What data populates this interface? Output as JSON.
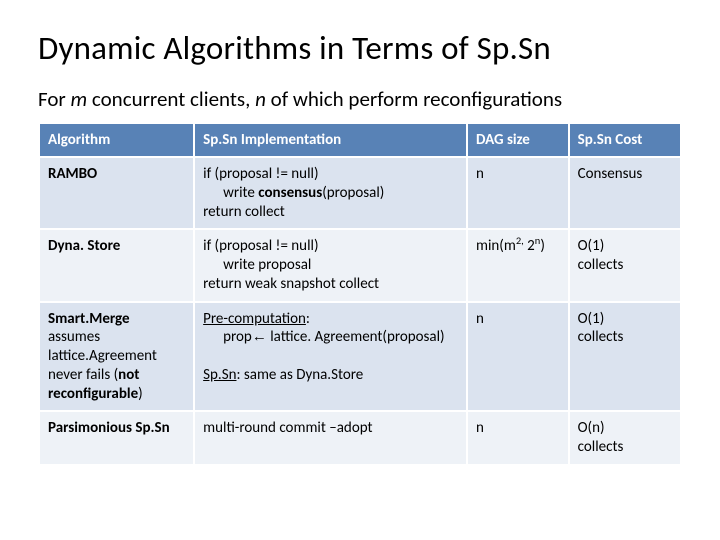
{
  "title": "Dynamic Algorithms in Terms of Sp.Sn",
  "subtitle_pre": "For ",
  "subtitle_m": "m",
  "subtitle_mid": " concurrent clients, ",
  "subtitle_n": "n",
  "subtitle_post": " of which perform reconfigurations",
  "head": {
    "c1": "Algorithm",
    "c2": "Sp.Sn Implementation",
    "c3": "DAG size",
    "c4": "Sp.Sn Cost"
  },
  "row1": {
    "algo": "RAMBO",
    "impl_l1": "if (proposal != null)",
    "impl_l2a": "write ",
    "impl_l2b": "consensus",
    "impl_l2c": "(proposal)",
    "impl_l3": "return collect",
    "dag": "n",
    "cost": "Consensus"
  },
  "row2": {
    "algo": "Dyna. Store",
    "impl_l1": "if (proposal != null)",
    "impl_l2": "write proposal",
    "impl_l3": "return weak snapshot collect",
    "dag_a": "min(m",
    "dag_b": "2,",
    "dag_c": " 2",
    "dag_d": "n",
    "dag_e": ")",
    "cost_l1": "O(1)",
    "cost_l2": "collects"
  },
  "row3": {
    "algo_l1": "Smart.Merge",
    "algo_l2": "assumes lattice.Agreement never fails (",
    "algo_l3": "not reconfigurable",
    "algo_l4": ")",
    "impl_l1": "Pre-computation",
    "impl_l1b": ":",
    "impl_l2a": "prop",
    "impl_l2b": " lattice. Agreement(proposal)",
    "impl_l3a": "Sp.Sn",
    "impl_l3b": ": same as Dyna.Store",
    "dag": "n",
    "cost_l1": "O(1)",
    "cost_l2": "collects"
  },
  "row4": {
    "algo": "Parsimonious Sp.Sn",
    "impl": "multi-round commit –adopt",
    "dag": "n",
    "cost_l1": "O(n)",
    "cost_l2": "collects"
  }
}
